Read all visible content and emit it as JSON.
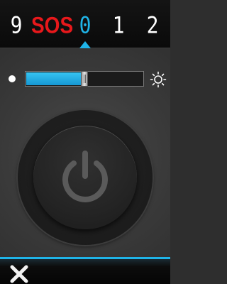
{
  "mode_bar": {
    "modes": [
      {
        "label": "9"
      },
      {
        "label": "SOS"
      },
      {
        "label": "0"
      },
      {
        "label": "1"
      },
      {
        "label": "2"
      }
    ],
    "selected_index": 2
  },
  "brightness": {
    "level_fraction": 0.5,
    "min_icon": "dot-icon",
    "max_icon": "sun-icon"
  },
  "power_button": {
    "icon": "power-icon"
  },
  "bottom_bar": {
    "close_icon": "close-icon"
  },
  "colors": {
    "accent": "#1fb4e8",
    "sos": "#e8181b",
    "text": "#ffffff"
  }
}
